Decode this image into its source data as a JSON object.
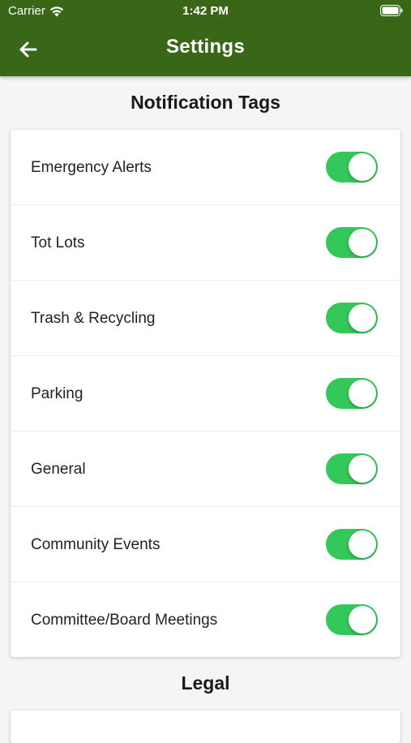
{
  "status_bar": {
    "carrier": "Carrier",
    "time": "1:42 PM"
  },
  "app_bar": {
    "title": "Settings",
    "back_icon": "arrow-left-icon"
  },
  "sections": {
    "notification_tags": {
      "title": "Notification Tags",
      "items": [
        {
          "label": "Emergency Alerts",
          "enabled": true
        },
        {
          "label": "Tot Lots",
          "enabled": true
        },
        {
          "label": "Trash & Recycling",
          "enabled": true
        },
        {
          "label": "Parking",
          "enabled": true
        },
        {
          "label": "General",
          "enabled": true
        },
        {
          "label": "Community Events",
          "enabled": true
        },
        {
          "label": "Committee/Board Meetings",
          "enabled": true
        }
      ]
    },
    "legal": {
      "title": "Legal"
    }
  },
  "colors": {
    "app_bar": "#3a6618",
    "toggle_on": "#34c759",
    "background": "#f5f5f5"
  }
}
